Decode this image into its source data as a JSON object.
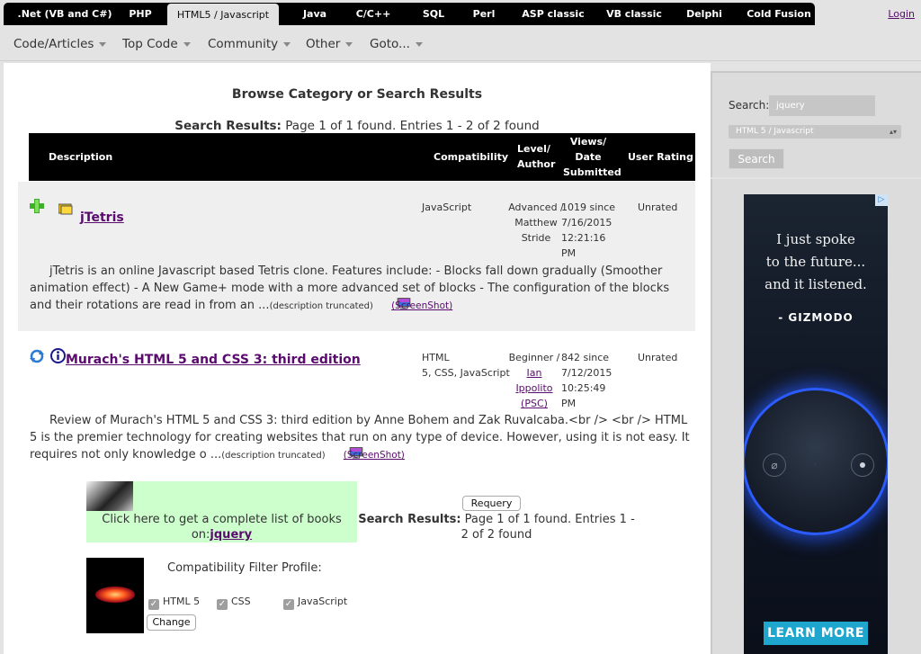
{
  "top_tabs": [
    {
      "label": ".Net (VB and C#)"
    },
    {
      "label": "PHP"
    },
    {
      "label": "HTML5 / Javascript"
    },
    {
      "label": "Java"
    },
    {
      "label": "C/C++"
    },
    {
      "label": "SQL"
    },
    {
      "label": "Perl"
    },
    {
      "label": "ASP classic"
    },
    {
      "label": "VB classic"
    },
    {
      "label": "Delphi"
    },
    {
      "label": "Cold Fusion"
    }
  ],
  "login_label": "Login",
  "menu": [
    {
      "label": "Code/Articles"
    },
    {
      "label": "Top Code"
    },
    {
      "label": "Community"
    },
    {
      "label": "Other"
    },
    {
      "label": "Goto..."
    }
  ],
  "page_title": "Browse Category or Search Results",
  "results": {
    "label": "Search Results:",
    "text": "Page 1 of 1 found. Entries 1 - 2 of 2 found"
  },
  "table_headers": {
    "description": "Description",
    "compatibility": "Compatibility",
    "level_author": [
      "Level/",
      "Author"
    ],
    "views_date": [
      "Views/",
      "Date",
      "Submitted"
    ],
    "rating": "User Rating"
  },
  "entries": [
    {
      "title": "jTetris",
      "compatibility": "JavaScript",
      "level": "Advanced /",
      "author": [
        "Matthew",
        "Stride"
      ],
      "views": "1019 since",
      "date": "7/16/2015",
      "time": "12:21:16",
      "ampm": "PM",
      "rating": "Unrated",
      "description": "jTetris is an online Javascript based Tetris clone. Features include: - Blocks fall down gradually (Smoother animation effect) - A New Game+ mode with a more advanced set of blocks - The configuration of the blocks and their rotations are read in from an ...",
      "truncated": "(description truncated)",
      "screenshot": "(ScreenShot)",
      "icon_left": "plus-icon",
      "icon_right": "folder-icon"
    },
    {
      "title": "Murach's HTML 5 and CSS 3: third edition",
      "compatibility": [
        "HTML",
        "5, CSS, JavaScript"
      ],
      "level": "Beginner /",
      "author": [
        "Ian",
        "Ippolito",
        "(PSC)"
      ],
      "views": "842 since",
      "date": "7/12/2015",
      "time": "10:25:49",
      "ampm": "PM",
      "rating": "Unrated",
      "description": "Review of Murach's HTML 5 and CSS 3: third edition by Anne Bohem and Zak Ruvalcaba.<br /> <br /> HTML 5 is the premier technology for creating websites that run on any type of device. However, using it is not easy. It requires not only knowledge o ...",
      "truncated": "(description truncated)",
      "screenshot": "(ScreenShot)",
      "icon_left": "refresh-icon",
      "icon_right": "info-icon"
    }
  ],
  "books": {
    "text": "Click here to get a complete list of books on:",
    "link": "jquery"
  },
  "requery_label": "Requery",
  "results2": {
    "label": "Search Results:",
    "text": "Page 1 of 1 found. Entries 1 - 2 of 2 found"
  },
  "filter": {
    "title": "Compatibility Filter Profile:",
    "options": [
      {
        "label": "HTML 5",
        "checked": true
      },
      {
        "label": "CSS",
        "checked": true
      },
      {
        "label": "JavaScript",
        "checked": true
      }
    ],
    "change_label": "Change"
  },
  "sidebar": {
    "search_label": "Search:",
    "search_value": "jquery",
    "category_selected": "HTML 5 / Javascript",
    "search_button": "Search"
  },
  "ad": {
    "badge": "▷",
    "quote": [
      "I just spoke",
      "to the future...",
      "and it listened."
    ],
    "source": "- GIZMODO",
    "cta": "LEARN MORE"
  }
}
